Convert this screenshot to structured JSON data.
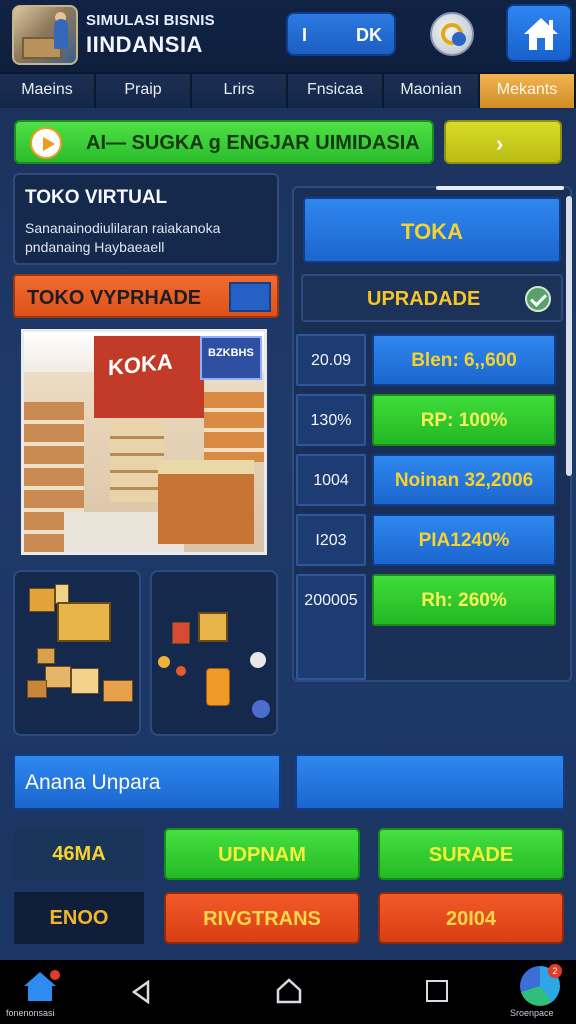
{
  "header": {
    "subtitle": "SIMULASI BISNIS",
    "title": "IINDANSIA",
    "coin_left": "I",
    "coin_right": "DK",
    "profile_icon": "profile-globe-icon",
    "home_icon": "home-icon"
  },
  "tabs": [
    {
      "label": "Maeins"
    },
    {
      "label": "Praip"
    },
    {
      "label": "Lrirs"
    },
    {
      "label": "Fnsicaa"
    },
    {
      "label": "Maonian"
    },
    {
      "label": "Mekants"
    }
  ],
  "banner": {
    "text": "AI— SUGKA g ENGJAR UIMIDASIA",
    "next_label": "›"
  },
  "info_card": {
    "heading": "TOKO VIRTUAL",
    "body": "Sananainodiulilaran raiakanoka pndanaing Haybaeaell"
  },
  "shop_section": {
    "title": "TOKO VYPRHADE",
    "storefront_sign": "KOKA",
    "side_sign": "BZKBHS"
  },
  "right_panel": {
    "toka_label": "TOKA",
    "upgrade_label": "UPRADADE",
    "stats": [
      {
        "left": "20.09",
        "right": "Blen: 6,,600",
        "color": "blue"
      },
      {
        "left": "130%",
        "right": "RP: 100%",
        "color": "green"
      },
      {
        "left": "1004",
        "right": "Noinan 32,2006",
        "color": "blue"
      },
      {
        "left": "I203",
        "right": "PIA1240%",
        "color": "blue"
      },
      {
        "left": "200005",
        "right": "Rh: 260%",
        "color": "green"
      }
    ]
  },
  "input_row": {
    "left_value": "Anana Unpara",
    "right_value": ""
  },
  "grid": {
    "row1": {
      "label": "46MA",
      "btn1": "UDPNAM",
      "btn2": "SURADE"
    },
    "row2": {
      "label": "ENOO",
      "btn1": "RIVGTRANS",
      "btn2": "20I04"
    }
  },
  "navbar": {
    "left_caption": "fonenonsasi",
    "right_caption": "Sroenpace",
    "right_badge": "2"
  },
  "colors": {
    "accent_blue": "#1b66cf",
    "accent_green": "#24ba25",
    "accent_orange": "#de5219",
    "gold_text": "#f5d22c"
  }
}
